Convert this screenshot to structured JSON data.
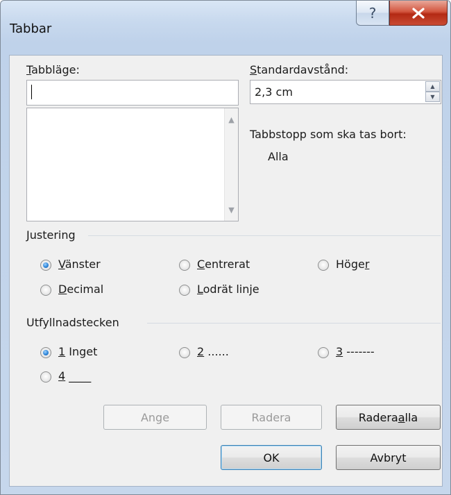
{
  "window": {
    "title": "Tabbar",
    "help_glyph": "?",
    "close_glyph": "x"
  },
  "tab_position": {
    "label_u": "T",
    "label_rest": "abbläge:",
    "value": "",
    "list_items": []
  },
  "default_spacing": {
    "label_u": "S",
    "label_rest": "tandardavstånd:",
    "value": "2,3 cm"
  },
  "to_clear": {
    "label": "Tabbstopp som ska tas bort:",
    "value": "Alla"
  },
  "alignment": {
    "group_label": "Justering",
    "options": [
      {
        "u": "V",
        "rest": "änster",
        "pre": "",
        "selected": true
      },
      {
        "u": "C",
        "rest": "entrerat",
        "pre": "",
        "selected": false
      },
      {
        "u": "r",
        "rest": "",
        "pre": "Höge",
        "selected": false
      },
      {
        "u": "D",
        "rest": "ecimal",
        "pre": "",
        "selected": false
      },
      {
        "u": "L",
        "rest": "odrät linje",
        "pre": "",
        "selected": false
      }
    ]
  },
  "leader": {
    "group_label": "Utfyllnadstecken",
    "options": [
      {
        "u": "1",
        "rest": " Inget",
        "selected": true
      },
      {
        "u": "2",
        "rest": " ......",
        "selected": false
      },
      {
        "u": "3",
        "rest": " -------",
        "selected": false
      },
      {
        "u": "4",
        "rest": " ____",
        "selected": false
      }
    ]
  },
  "buttons": {
    "set": "Ange",
    "clear": "Radera",
    "clear_all_pre": "Radera ",
    "clear_all_u": "a",
    "clear_all_rest": "lla",
    "ok": "OK",
    "cancel": "Avbryt"
  },
  "colors": {
    "title_gradient_top": "#d9e6f5",
    "close_button_red": "#c94a33",
    "radio_selected_blue": "#2f86d9"
  }
}
